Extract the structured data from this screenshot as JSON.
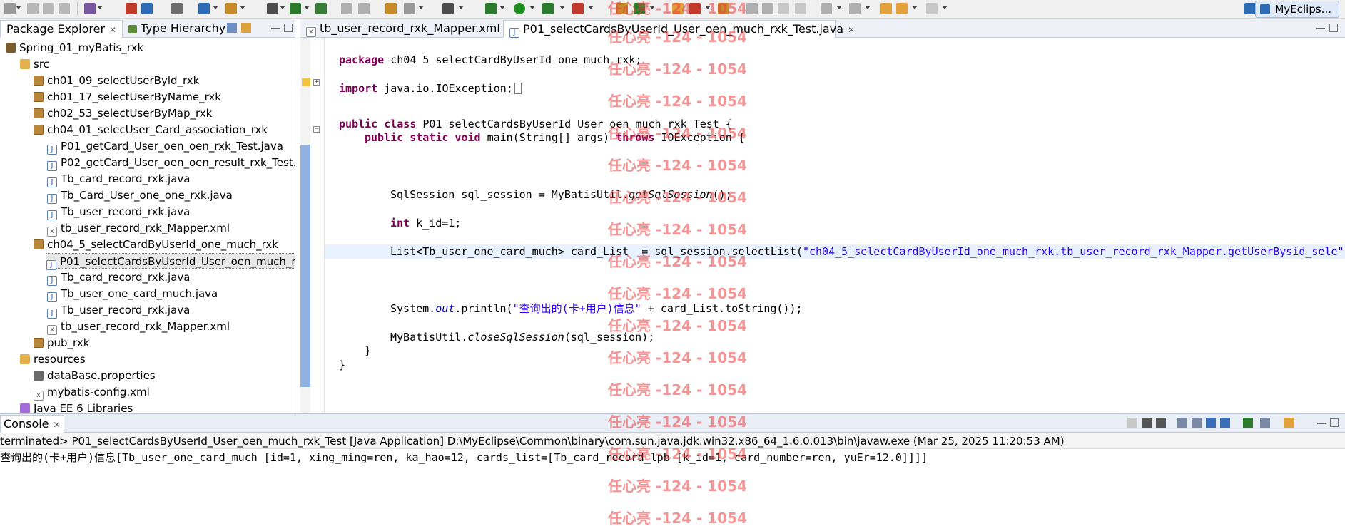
{
  "toolbar": {
    "perspective_label": "MyEclips...",
    "colors": {
      "bg": "#f0f0f0",
      "icons": [
        "#9a9a9a",
        "#2c7a2c",
        "#2d6bb5",
        "#c78b2a",
        "#7a55a0",
        "#c0392b"
      ]
    }
  },
  "explorer": {
    "tabs": [
      {
        "label": "Package Explorer"
      },
      {
        "label": "Type Hierarchy"
      }
    ],
    "tree": [
      {
        "label": "Spring_01_myBatis_rxk",
        "icon": "project-icon"
      },
      {
        "label": "src",
        "icon": "source-folder-icon"
      },
      {
        "label": "ch01_09_selectUserByld_rxk",
        "icon": "package-icon"
      },
      {
        "label": "ch01_17_selectUserByName_rxk",
        "icon": "package-icon"
      },
      {
        "label": "ch02_53_selectUserByMap_rxk",
        "icon": "package-icon"
      },
      {
        "label": "ch04_01_selecUser_Card_association_rxk",
        "icon": "package-icon"
      },
      {
        "label": "P01_getCard_User_oen_oen_rxk_Test.java",
        "icon": "java-file-icon"
      },
      {
        "label": "P02_getCard_User_oen_oen_result_rxk_Test.j",
        "icon": "java-file-icon"
      },
      {
        "label": "Tb_card_record_rxk.java",
        "icon": "java-file-icon"
      },
      {
        "label": "Tb_Card_User_one_one_rxk.java",
        "icon": "java-file-icon"
      },
      {
        "label": "Tb_user_record_rxk.java",
        "icon": "java-file-icon"
      },
      {
        "label": "tb_user_record_rxk_Mapper.xml",
        "icon": "xml-file-icon"
      },
      {
        "label": "ch04_5_selectCardByUserId_one_much_rxk",
        "icon": "package-icon"
      },
      {
        "label": "P01_selectCardsByUserId_User_oen_much_rx",
        "icon": "java-file-icon"
      },
      {
        "label": "Tb_card_record_rxk.java",
        "icon": "java-file-icon"
      },
      {
        "label": "Tb_user_one_card_much.java",
        "icon": "java-file-icon"
      },
      {
        "label": "Tb_user_record_rxk.java",
        "icon": "java-file-icon"
      },
      {
        "label": "tb_user_record_rxk_Mapper.xml",
        "icon": "xml-file-icon"
      },
      {
        "label": "pub_rxk",
        "icon": "package-icon"
      },
      {
        "label": "resources",
        "icon": "source-folder-icon"
      },
      {
        "label": "dataBase.properties",
        "icon": "properties-file-icon"
      },
      {
        "label": "mybatis-config.xml",
        "icon": "xml-file-icon"
      },
      {
        "label": "Java EE 6 Libraries",
        "icon": "library-icon"
      }
    ]
  },
  "editor": {
    "tabs": [
      {
        "label": "tb_user_record_rxk_Mapper.xml"
      },
      {
        "label": "P01_selectCardsByUserId_User_oen_much_rxk_Test.java"
      }
    ],
    "code": {
      "package_kw": "package",
      "package_name": " ch04_5_selectCardByUserId_one_much_rxk;",
      "import_kw": "import",
      "import_name": " java.io.IOException;",
      "class_decl": {
        "kw": "public class",
        "rest": " P01_selectCardsByUserId_User_oen_much_rxk_Test {"
      },
      "main_decl": {
        "kw1": "public static void",
        "mid": " main(String[] args) ",
        "kw2": "throws",
        "rest": " IOException {"
      },
      "session_line": {
        "pre": "SqlSession sql_session = MyBatisUtil.",
        "call": "getSqlSession",
        "post": "();"
      },
      "int_line": {
        "kw": "int",
        "rest": " k_id=1;"
      },
      "list_line": {
        "pre": "List<Tb_user_one_card_much> card_List  = sql_session.selectList(",
        "str": "\"ch04_5_selectCardByUserId_one_much_rxk.tb_user_record_rxk_Mapper.getUserBysid_sele\""
      },
      "println_line": {
        "pre": "System.",
        "field": "out",
        "mid": ".println(",
        "str": "\"查询出的(卡+用户)信息\"",
        "post": " + card_List.toString());"
      },
      "close_line": {
        "pre": "MyBatisUtil.",
        "call": "closeSqlSession",
        "post": "(sql_session);"
      },
      "close_brace_inner": "}",
      "close_brace_outer": "}"
    }
  },
  "console": {
    "tab_label": "Console",
    "status": "terminated> P01_selectCardsByUserId_User_oen_much_rxk_Test [Java Application] D:\\MyEclipse\\Common\\binary\\com.sun.java.jdk.win32.x86_64_1.6.0.013\\bin\\javaw.exe (Mar 25, 2025 11:20:53 AM)",
    "output": "查询出的(卡+用户)信息[Tb_user_one_card_much [id=1, xing_ming=ren, ka_hao=12, cards_list=[Tb_card_record_lpb [k_id=1, card_number=ren, yuEr=12.0]]]]"
  },
  "watermark": {
    "text": "任心亮 -124 - 1054",
    "color": "#eb3c3c"
  }
}
